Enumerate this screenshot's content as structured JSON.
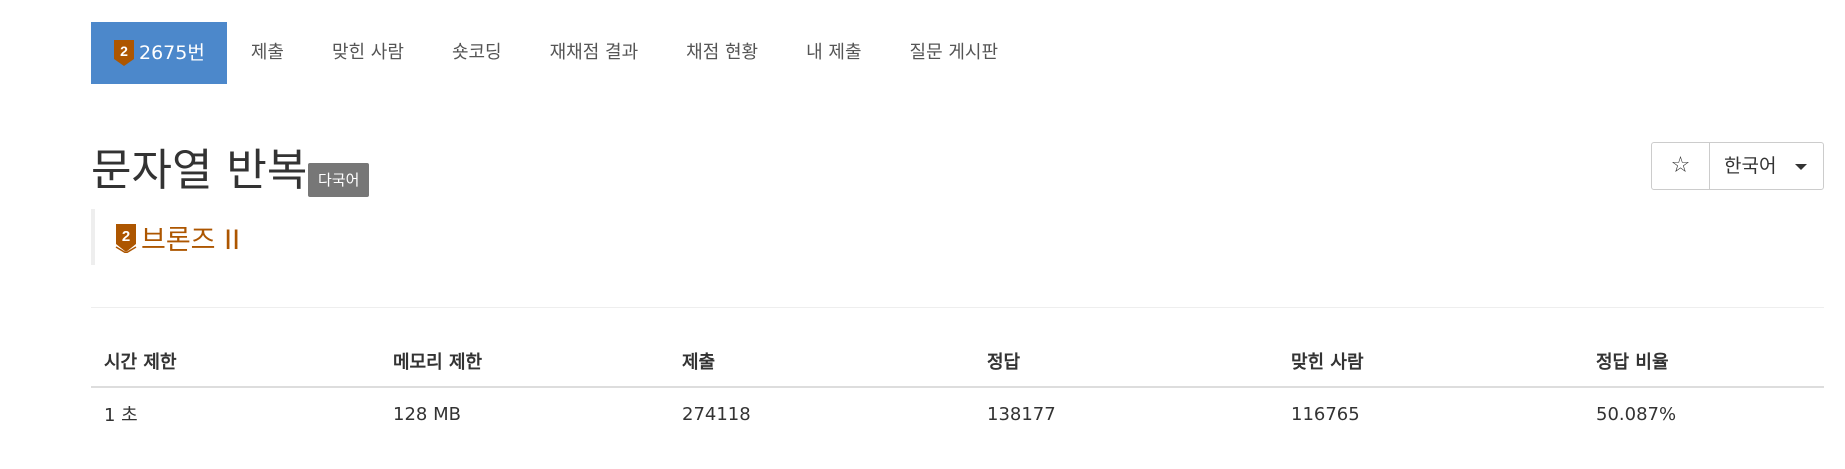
{
  "nav": {
    "tabs": [
      {
        "label": "2675번",
        "active": true
      },
      {
        "label": "제출"
      },
      {
        "label": "맞힌 사람"
      },
      {
        "label": "숏코딩"
      },
      {
        "label": "재채점 결과"
      },
      {
        "label": "채점 현황"
      },
      {
        "label": "내 제출"
      },
      {
        "label": "질문 게시판"
      }
    ]
  },
  "problem": {
    "title": "문자열 반복",
    "language_badge": "다국어",
    "tier": {
      "label": "브론즈 II",
      "number": "2",
      "color": "#ad5600"
    }
  },
  "actions": {
    "star_icon": "star-outline-icon",
    "star_glyph": "☆",
    "language": "한국어"
  },
  "colors": {
    "active_tab": "#4c88cb",
    "bronze": "#ad5600",
    "badge_gray": "#777777"
  },
  "table": {
    "headers": [
      "시간 제한",
      "메모리 제한",
      "제출",
      "정답",
      "맞힌 사람",
      "정답 비율"
    ],
    "row": [
      "1 초",
      "128 MB",
      "274118",
      "138177",
      "116765",
      "50.087%"
    ]
  }
}
